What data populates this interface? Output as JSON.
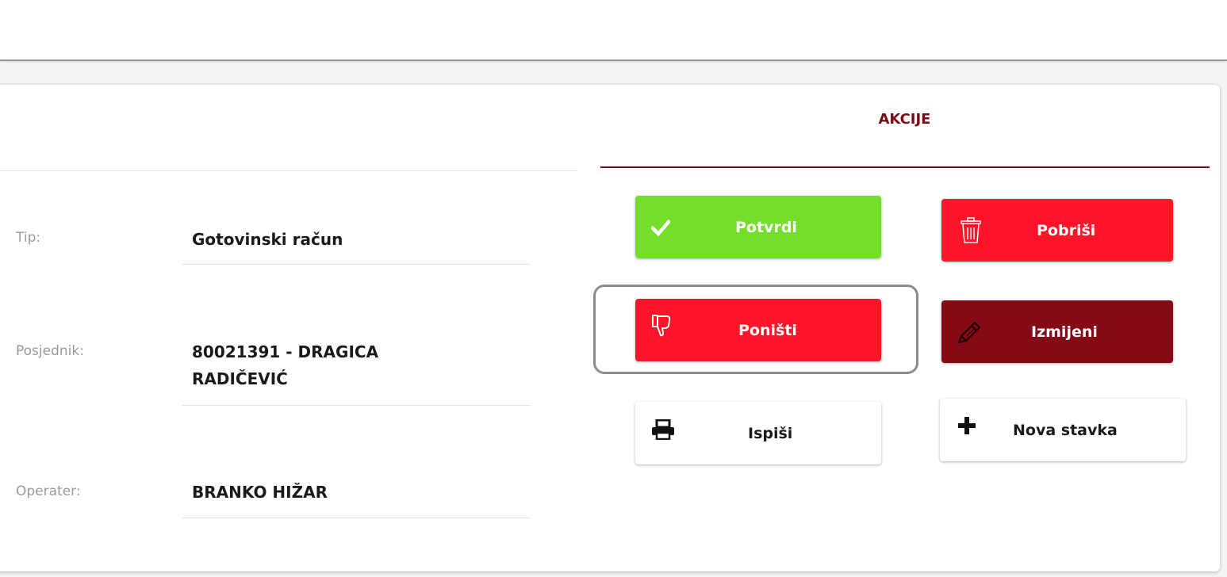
{
  "actions": {
    "title": "AKCIJE",
    "confirm_label": "Potvrdi",
    "delete_label": "Pobriši",
    "cancel_label": "Poništi",
    "edit_label": "Izmijeni",
    "print_label": "Ispiši",
    "new_item_label": "Nova stavka",
    "colors": {
      "accent": "#7b0a16",
      "confirm": "#74de2c",
      "danger": "#ff1428",
      "edit": "#860a15"
    }
  },
  "details": {
    "type_label": "Tip:",
    "type_value": "Gotovinski račun",
    "owner_label": "Posjednik:",
    "owner_value": "80021391 - DRAGICA RADIČEVIĆ",
    "operator_label": "Operater:",
    "operator_value": "BRANKO HIŽAR"
  },
  "icons": {
    "confirm": "check-icon",
    "delete": "trash-icon",
    "cancel": "thumbs-down-icon",
    "edit": "pencil-icon",
    "print": "printer-icon",
    "new_item": "plus-icon"
  }
}
